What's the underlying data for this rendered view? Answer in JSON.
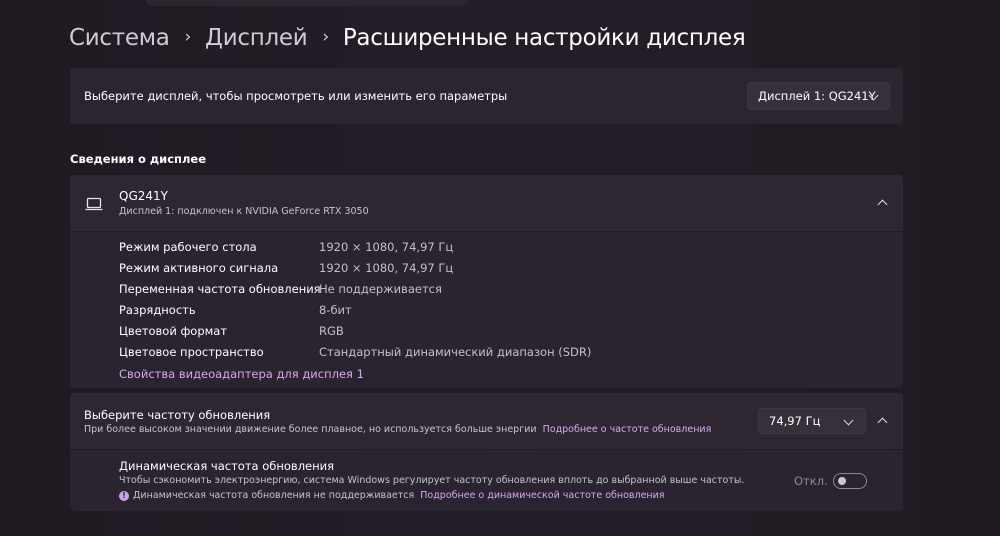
{
  "breadcrumb": {
    "items": [
      "Система",
      "Дисплей"
    ],
    "current": "Расширенные настройки дисплея",
    "separator": "›"
  },
  "display_select": {
    "label": "Выберите дисплей, чтобы просмотреть или изменить его параметры",
    "selected": "Дисплей 1: QG241Y"
  },
  "display_info": {
    "section_title": "Сведения о дисплее",
    "name": "QG241Y",
    "subtitle": "Дисплей 1: подключен к NVIDIA GeForce RTX 3050",
    "rows": [
      {
        "key": "Режим рабочего стола",
        "value": "1920 × 1080, 74,97 Гц"
      },
      {
        "key": "Режим активного сигнала",
        "value": "1920 × 1080, 74,97 Гц"
      },
      {
        "key": "Переменная частота обновления",
        "value": "Не поддерживается"
      },
      {
        "key": "Разрядность",
        "value": "8-бит"
      },
      {
        "key": "Цветовой формат",
        "value": "RGB"
      },
      {
        "key": "Цветовое пространство",
        "value": "Стандартный динамический диапазон (SDR)"
      }
    ],
    "adapter_link": "Свойства видеоадаптера для дисплея 1"
  },
  "refresh_rate": {
    "title": "Выберите частоту обновления",
    "description": "При более высоком значении движение более плавное, но используется больше энергии",
    "more_link": "Подробнее о частоте обновления",
    "selected": "74,97 Гц"
  },
  "dynamic_refresh": {
    "title": "Динамическая частота обновления",
    "description": "Чтобы сэкономить электроэнергию, система Windows регулирует частоту обновления вплоть до выбранной выше частоты.",
    "warning": "Динамическая частота обновления не поддерживается",
    "more_link": "Подробнее о динамической частоте обновления",
    "toggle_state": "Откл.",
    "toggle_on": false
  },
  "icons": {
    "monitor": "laptop-icon",
    "info": "info-icon"
  },
  "colors": {
    "accent_link": "#d9a8ef"
  }
}
